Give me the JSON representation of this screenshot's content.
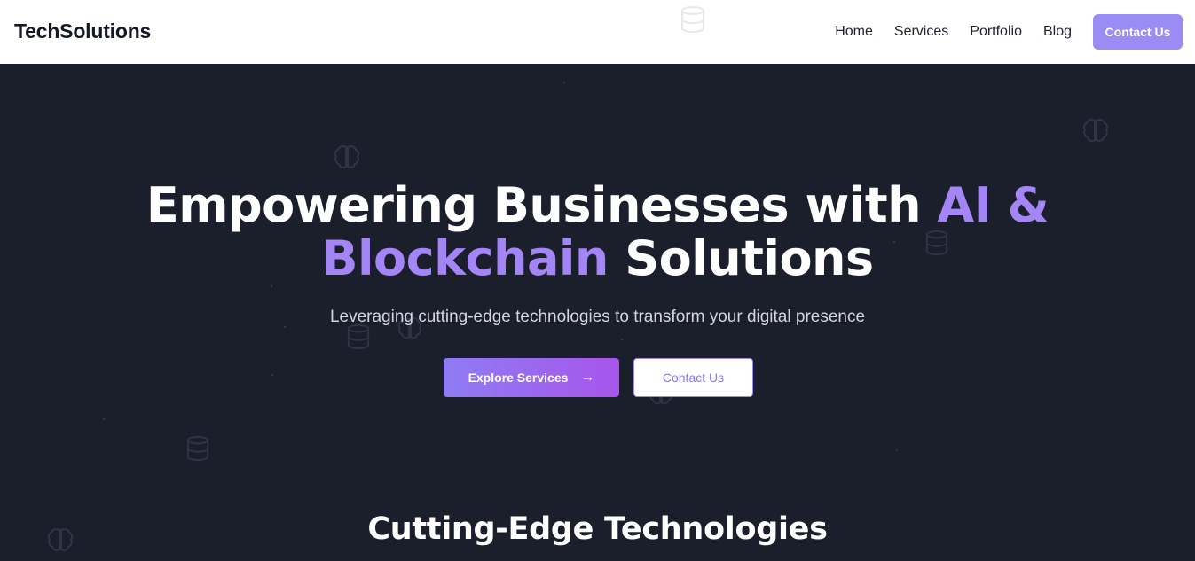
{
  "brand": {
    "name": "TechSolutions"
  },
  "nav": {
    "links": [
      "Home",
      "Services",
      "Portfolio",
      "Blog"
    ],
    "cta_label": "Contact Us"
  },
  "hero": {
    "headline_part1": "Empowering Businesses with ",
    "headline_accent1": "AI &",
    "headline_accent2": "Blockchain",
    "headline_part2": " Solutions",
    "subtitle": "Leveraging cutting-edge technologies to transform your digital presence",
    "primary_button": "Explore Services",
    "primary_button_icon": "arrow-right-icon",
    "secondary_button": "Contact Us"
  },
  "section": {
    "title": "Cutting-Edge Technologies"
  },
  "colors": {
    "accent": "#a485f5",
    "nav_cta": "#9b8cf4",
    "hero_background": "#1b1f2c",
    "gradient_start": "#8e7cf2",
    "gradient_end": "#a855ec"
  },
  "decorative_icons": [
    "brain-icon",
    "database-icon"
  ]
}
